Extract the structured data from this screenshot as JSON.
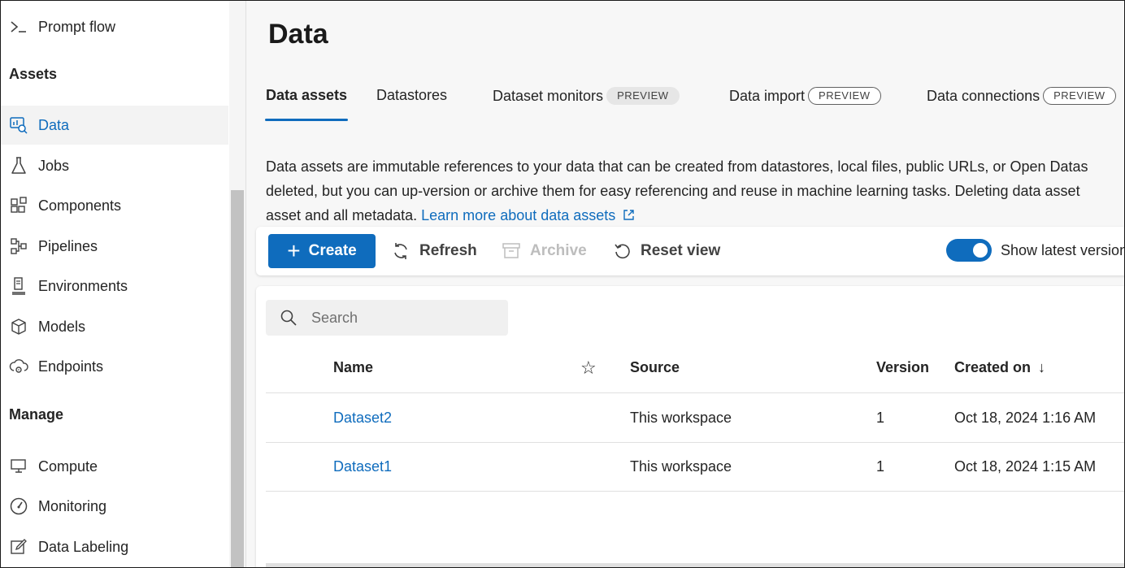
{
  "sidebar": {
    "top_item": {
      "label": "Prompt flow",
      "icon": "prompt-flow-icon"
    },
    "assets_heading": "Assets",
    "assets_items": [
      {
        "label": "Data",
        "icon": "data-icon",
        "active": true
      },
      {
        "label": "Jobs",
        "icon": "flask-icon"
      },
      {
        "label": "Components",
        "icon": "components-icon"
      },
      {
        "label": "Pipelines",
        "icon": "pipelines-icon"
      },
      {
        "label": "Environments",
        "icon": "environments-icon"
      },
      {
        "label": "Models",
        "icon": "cube-icon"
      },
      {
        "label": "Endpoints",
        "icon": "endpoints-icon"
      }
    ],
    "manage_heading": "Manage",
    "manage_items": [
      {
        "label": "Compute",
        "icon": "monitor-icon"
      },
      {
        "label": "Monitoring",
        "icon": "gauge-icon"
      },
      {
        "label": "Data Labeling",
        "icon": "edit-icon"
      }
    ]
  },
  "main": {
    "title": "Data",
    "tabs": [
      {
        "label": "Data assets",
        "active": true
      },
      {
        "label": "Datastores"
      },
      {
        "label": "Dataset monitors",
        "badge": "PREVIEW"
      },
      {
        "label": "Data import",
        "badge": "PREVIEW"
      },
      {
        "label": "Data connections",
        "badge": "PREVIEW"
      }
    ],
    "description": {
      "line1": "Data assets are immutable references to your data that can be created from datastores, local files, public URLs, or Open Datas",
      "line2": "deleted, but you can up-version or archive them for easy referencing and reuse in machine learning tasks. Deleting data asset",
      "line3": "asset and all metadata.",
      "link": "Learn more about data assets"
    },
    "toolbar": {
      "create": "Create",
      "refresh": "Refresh",
      "archive": "Archive",
      "reset_view": "Reset view",
      "toggle_label": "Show latest version",
      "toggle_on": true
    },
    "search": {
      "placeholder": "Search"
    },
    "table": {
      "columns": {
        "name": "Name",
        "source": "Source",
        "version": "Version",
        "created_on": "Created on"
      },
      "sort_indicator": "↓",
      "rows": [
        {
          "name": "Dataset2",
          "source": "This workspace",
          "version": "1",
          "created_on": "Oct 18, 2024 1:16 AM"
        },
        {
          "name": "Dataset1",
          "source": "This workspace",
          "version": "1",
          "created_on": "Oct 18, 2024 1:15 AM"
        }
      ]
    }
  },
  "colors": {
    "accent": "#0f6cbd",
    "active_bg": "#f3f3f3",
    "main_bg": "#f7f7f7"
  }
}
